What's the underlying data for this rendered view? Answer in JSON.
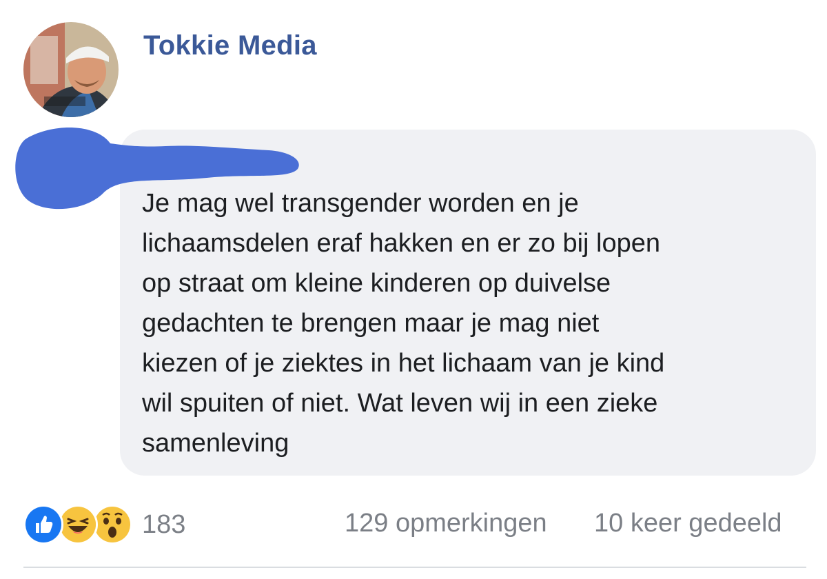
{
  "post": {
    "page_name": "Tokkie Media",
    "avatar_icon": "user-photo-avatar"
  },
  "comment": {
    "author_redacted": true,
    "redaction_color": "#4a6fd6",
    "text": "Je mag wel transgender worden en je\nlichaamsdelen eraf hakken en er zo bij lopen\nop straat om kleine kinderen op duivelse\ngedachten te brengen maar je mag niet\nkiezen of je ziektes in het lichaam van je kind\nwil spuiten of niet. Wat leven wij in een zieke\nsamenleving"
  },
  "footer": {
    "reactions": [
      "like-icon",
      "haha-icon",
      "wow-icon"
    ],
    "reaction_count": "183",
    "comments_label": "129 opmerkingen",
    "shares_label": "10 keer gedeeld"
  },
  "colors": {
    "brand_blue": "#3b5998",
    "bubble_bg": "#f0f1f4",
    "meta_text": "#7b7f86",
    "like_blue": "#1877f2",
    "emoji_yellow": "#f7c43f"
  }
}
